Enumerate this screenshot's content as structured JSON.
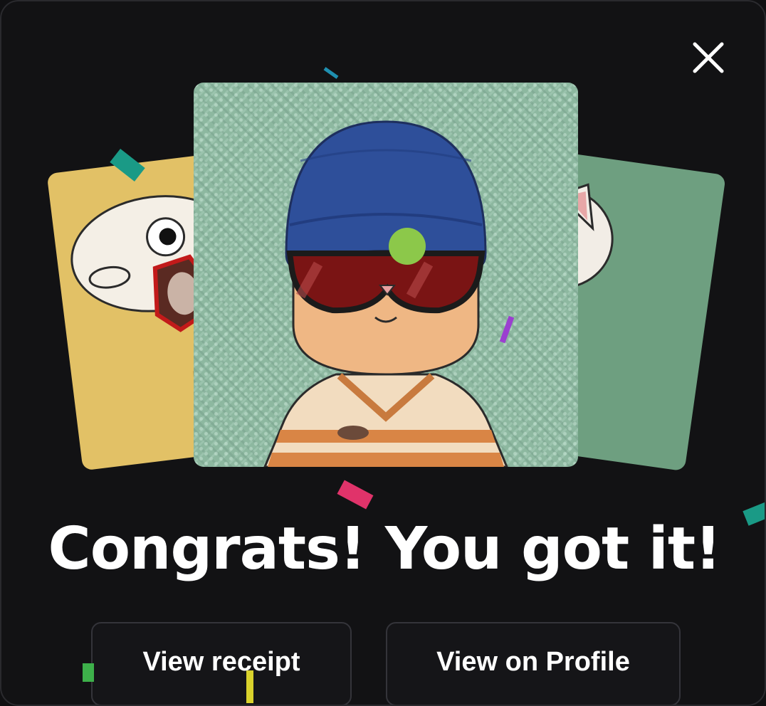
{
  "modal": {
    "title": "Congrats! You got it!",
    "close_icon": "close-icon"
  },
  "actions": {
    "view_receipt_label": "View receipt",
    "view_profile_label": "View on Profile"
  },
  "cards": {
    "left_background": "#e2c166",
    "center_background": "#8db8a0",
    "right_background": "#6e9f80"
  },
  "colors": {
    "background": "#121214",
    "button_border": "#34343a",
    "text": "#ffffff"
  }
}
